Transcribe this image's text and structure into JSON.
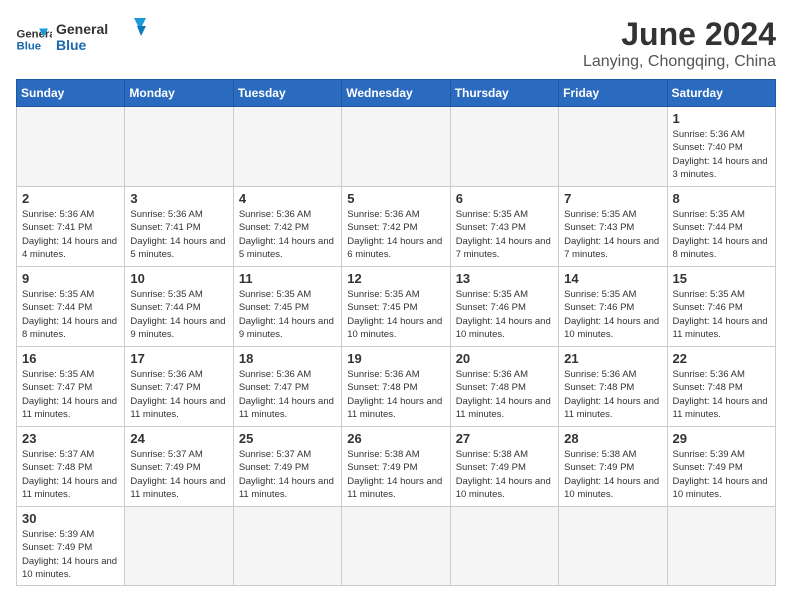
{
  "header": {
    "logo_general": "General",
    "logo_blue": "Blue",
    "month_year": "June 2024",
    "location": "Lanying, Chongqing, China"
  },
  "weekdays": [
    "Sunday",
    "Monday",
    "Tuesday",
    "Wednesday",
    "Thursday",
    "Friday",
    "Saturday"
  ],
  "weeks": [
    [
      {
        "day": "",
        "empty": true
      },
      {
        "day": "",
        "empty": true
      },
      {
        "day": "",
        "empty": true
      },
      {
        "day": "",
        "empty": true
      },
      {
        "day": "",
        "empty": true
      },
      {
        "day": "",
        "empty": true
      },
      {
        "day": "1",
        "sunrise": "5:36 AM",
        "sunset": "7:40 PM",
        "daylight": "14 hours and 3 minutes."
      }
    ],
    [
      {
        "day": "2",
        "sunrise": "5:36 AM",
        "sunset": "7:41 PM",
        "daylight": "14 hours and 4 minutes."
      },
      {
        "day": "3",
        "sunrise": "5:36 AM",
        "sunset": "7:41 PM",
        "daylight": "14 hours and 5 minutes."
      },
      {
        "day": "4",
        "sunrise": "5:36 AM",
        "sunset": "7:42 PM",
        "daylight": "14 hours and 5 minutes."
      },
      {
        "day": "5",
        "sunrise": "5:36 AM",
        "sunset": "7:42 PM",
        "daylight": "14 hours and 6 minutes."
      },
      {
        "day": "6",
        "sunrise": "5:35 AM",
        "sunset": "7:43 PM",
        "daylight": "14 hours and 7 minutes."
      },
      {
        "day": "7",
        "sunrise": "5:35 AM",
        "sunset": "7:43 PM",
        "daylight": "14 hours and 7 minutes."
      },
      {
        "day": "8",
        "sunrise": "5:35 AM",
        "sunset": "7:44 PM",
        "daylight": "14 hours and 8 minutes."
      }
    ],
    [
      {
        "day": "9",
        "sunrise": "5:35 AM",
        "sunset": "7:44 PM",
        "daylight": "14 hours and 8 minutes."
      },
      {
        "day": "10",
        "sunrise": "5:35 AM",
        "sunset": "7:44 PM",
        "daylight": "14 hours and 9 minutes."
      },
      {
        "day": "11",
        "sunrise": "5:35 AM",
        "sunset": "7:45 PM",
        "daylight": "14 hours and 9 minutes."
      },
      {
        "day": "12",
        "sunrise": "5:35 AM",
        "sunset": "7:45 PM",
        "daylight": "14 hours and 10 minutes."
      },
      {
        "day": "13",
        "sunrise": "5:35 AM",
        "sunset": "7:46 PM",
        "daylight": "14 hours and 10 minutes."
      },
      {
        "day": "14",
        "sunrise": "5:35 AM",
        "sunset": "7:46 PM",
        "daylight": "14 hours and 10 minutes."
      },
      {
        "day": "15",
        "sunrise": "5:35 AM",
        "sunset": "7:46 PM",
        "daylight": "14 hours and 11 minutes."
      }
    ],
    [
      {
        "day": "16",
        "sunrise": "5:35 AM",
        "sunset": "7:47 PM",
        "daylight": "14 hours and 11 minutes."
      },
      {
        "day": "17",
        "sunrise": "5:36 AM",
        "sunset": "7:47 PM",
        "daylight": "14 hours and 11 minutes."
      },
      {
        "day": "18",
        "sunrise": "5:36 AM",
        "sunset": "7:47 PM",
        "daylight": "14 hours and 11 minutes."
      },
      {
        "day": "19",
        "sunrise": "5:36 AM",
        "sunset": "7:48 PM",
        "daylight": "14 hours and 11 minutes."
      },
      {
        "day": "20",
        "sunrise": "5:36 AM",
        "sunset": "7:48 PM",
        "daylight": "14 hours and 11 minutes."
      },
      {
        "day": "21",
        "sunrise": "5:36 AM",
        "sunset": "7:48 PM",
        "daylight": "14 hours and 11 minutes."
      },
      {
        "day": "22",
        "sunrise": "5:36 AM",
        "sunset": "7:48 PM",
        "daylight": "14 hours and 11 minutes."
      }
    ],
    [
      {
        "day": "23",
        "sunrise": "5:37 AM",
        "sunset": "7:48 PM",
        "daylight": "14 hours and 11 minutes."
      },
      {
        "day": "24",
        "sunrise": "5:37 AM",
        "sunset": "7:49 PM",
        "daylight": "14 hours and 11 minutes."
      },
      {
        "day": "25",
        "sunrise": "5:37 AM",
        "sunset": "7:49 PM",
        "daylight": "14 hours and 11 minutes."
      },
      {
        "day": "26",
        "sunrise": "5:38 AM",
        "sunset": "7:49 PM",
        "daylight": "14 hours and 11 minutes."
      },
      {
        "day": "27",
        "sunrise": "5:38 AM",
        "sunset": "7:49 PM",
        "daylight": "14 hours and 10 minutes."
      },
      {
        "day": "28",
        "sunrise": "5:38 AM",
        "sunset": "7:49 PM",
        "daylight": "14 hours and 10 minutes."
      },
      {
        "day": "29",
        "sunrise": "5:39 AM",
        "sunset": "7:49 PM",
        "daylight": "14 hours and 10 minutes."
      }
    ],
    [
      {
        "day": "30",
        "sunrise": "5:39 AM",
        "sunset": "7:49 PM",
        "daylight": "14 hours and 10 minutes."
      },
      {
        "day": "",
        "empty": true
      },
      {
        "day": "",
        "empty": true
      },
      {
        "day": "",
        "empty": true
      },
      {
        "day": "",
        "empty": true
      },
      {
        "day": "",
        "empty": true
      },
      {
        "day": "",
        "empty": true
      }
    ]
  ],
  "labels": {
    "sunrise": "Sunrise:",
    "sunset": "Sunset:",
    "daylight": "Daylight:"
  }
}
